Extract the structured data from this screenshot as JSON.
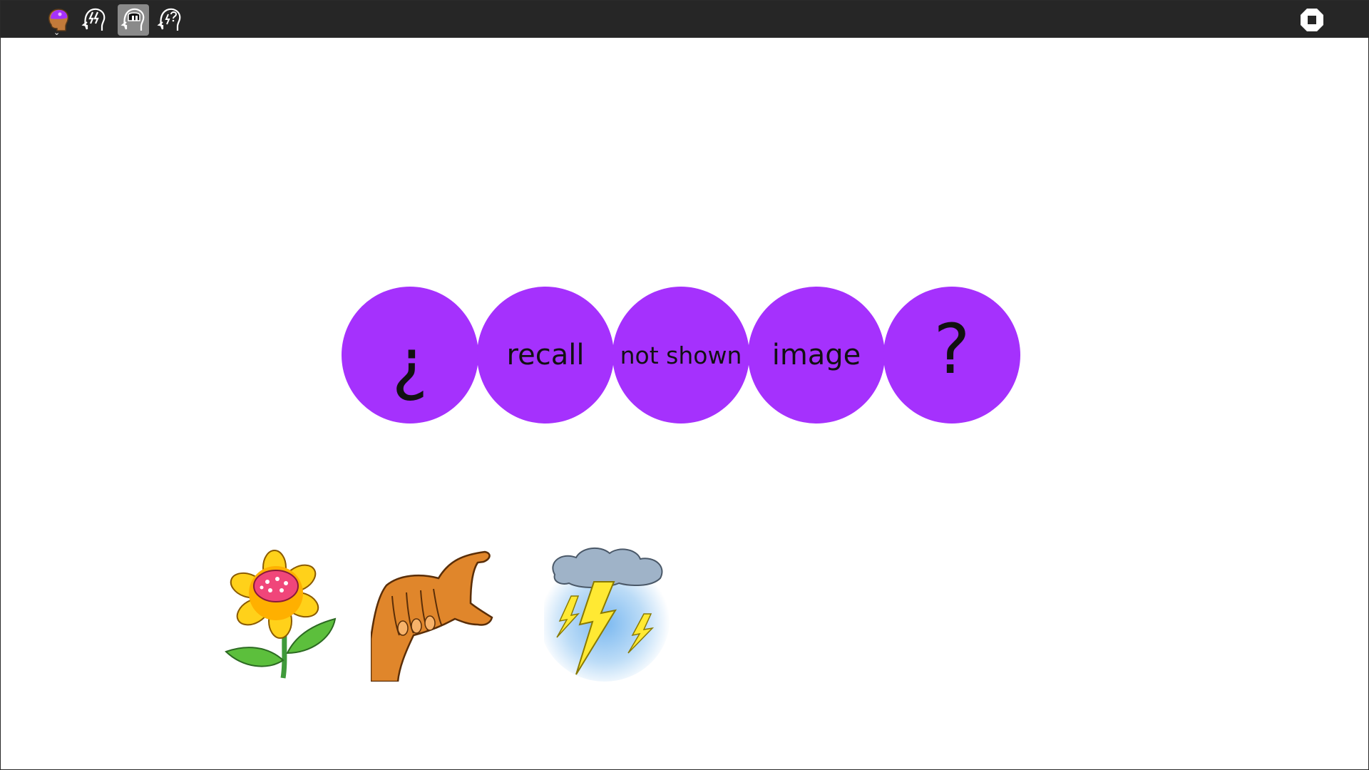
{
  "toolbar": {
    "buttons": [
      {
        "icon": "brain-head-purple-icon",
        "active": false
      },
      {
        "icon": "head-lightning-icon",
        "active": false
      },
      {
        "icon": "head-gap-icon",
        "active": true
      },
      {
        "icon": "head-bolt-question-icon",
        "active": false
      }
    ],
    "stop_icon": "stop-icon"
  },
  "accent_color": "#a531fd",
  "bubbles": [
    {
      "text": "¿"
    },
    {
      "text": "recall"
    },
    {
      "text": "not shown"
    },
    {
      "text": "image"
    },
    {
      "text": "?"
    }
  ],
  "pictures": [
    {
      "icon": "flower-icon"
    },
    {
      "icon": "hand-gesture-icon"
    },
    {
      "icon": "storm-cloud-lightning-icon"
    }
  ]
}
